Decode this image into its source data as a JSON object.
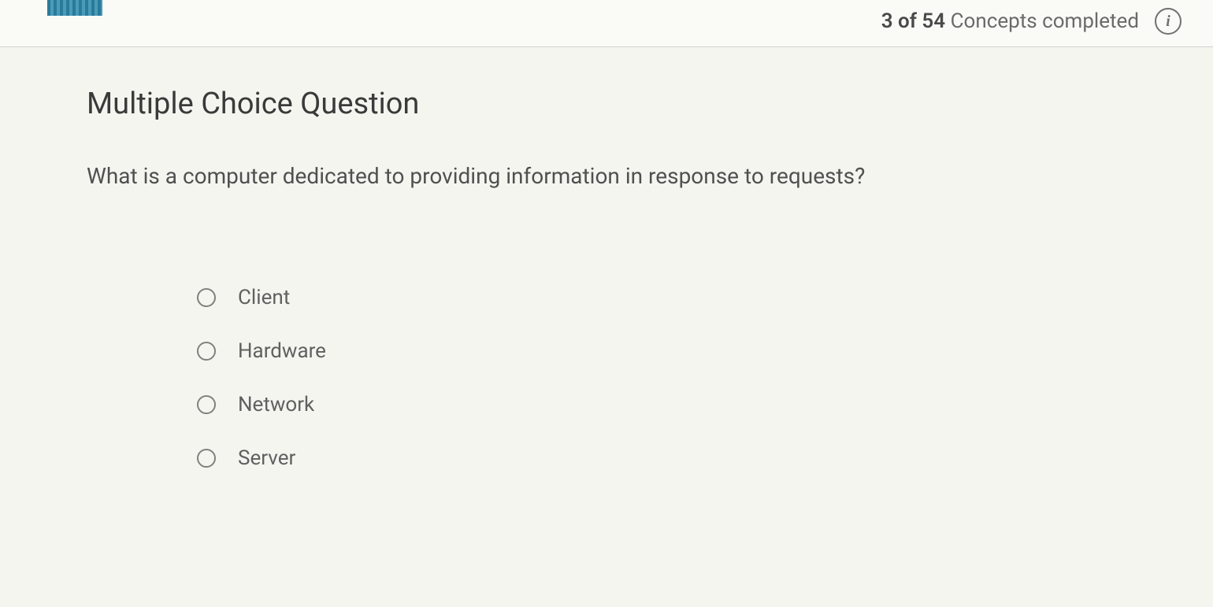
{
  "header": {
    "progress_count": "3 of 54",
    "progress_suffix": " Concepts completed",
    "info_glyph": "i"
  },
  "question": {
    "type_heading": "Multiple Choice Question",
    "text": "What is a computer dedicated to providing information in response to requests?"
  },
  "options": [
    {
      "label": "Client"
    },
    {
      "label": "Hardware"
    },
    {
      "label": "Network"
    },
    {
      "label": "Server"
    }
  ]
}
